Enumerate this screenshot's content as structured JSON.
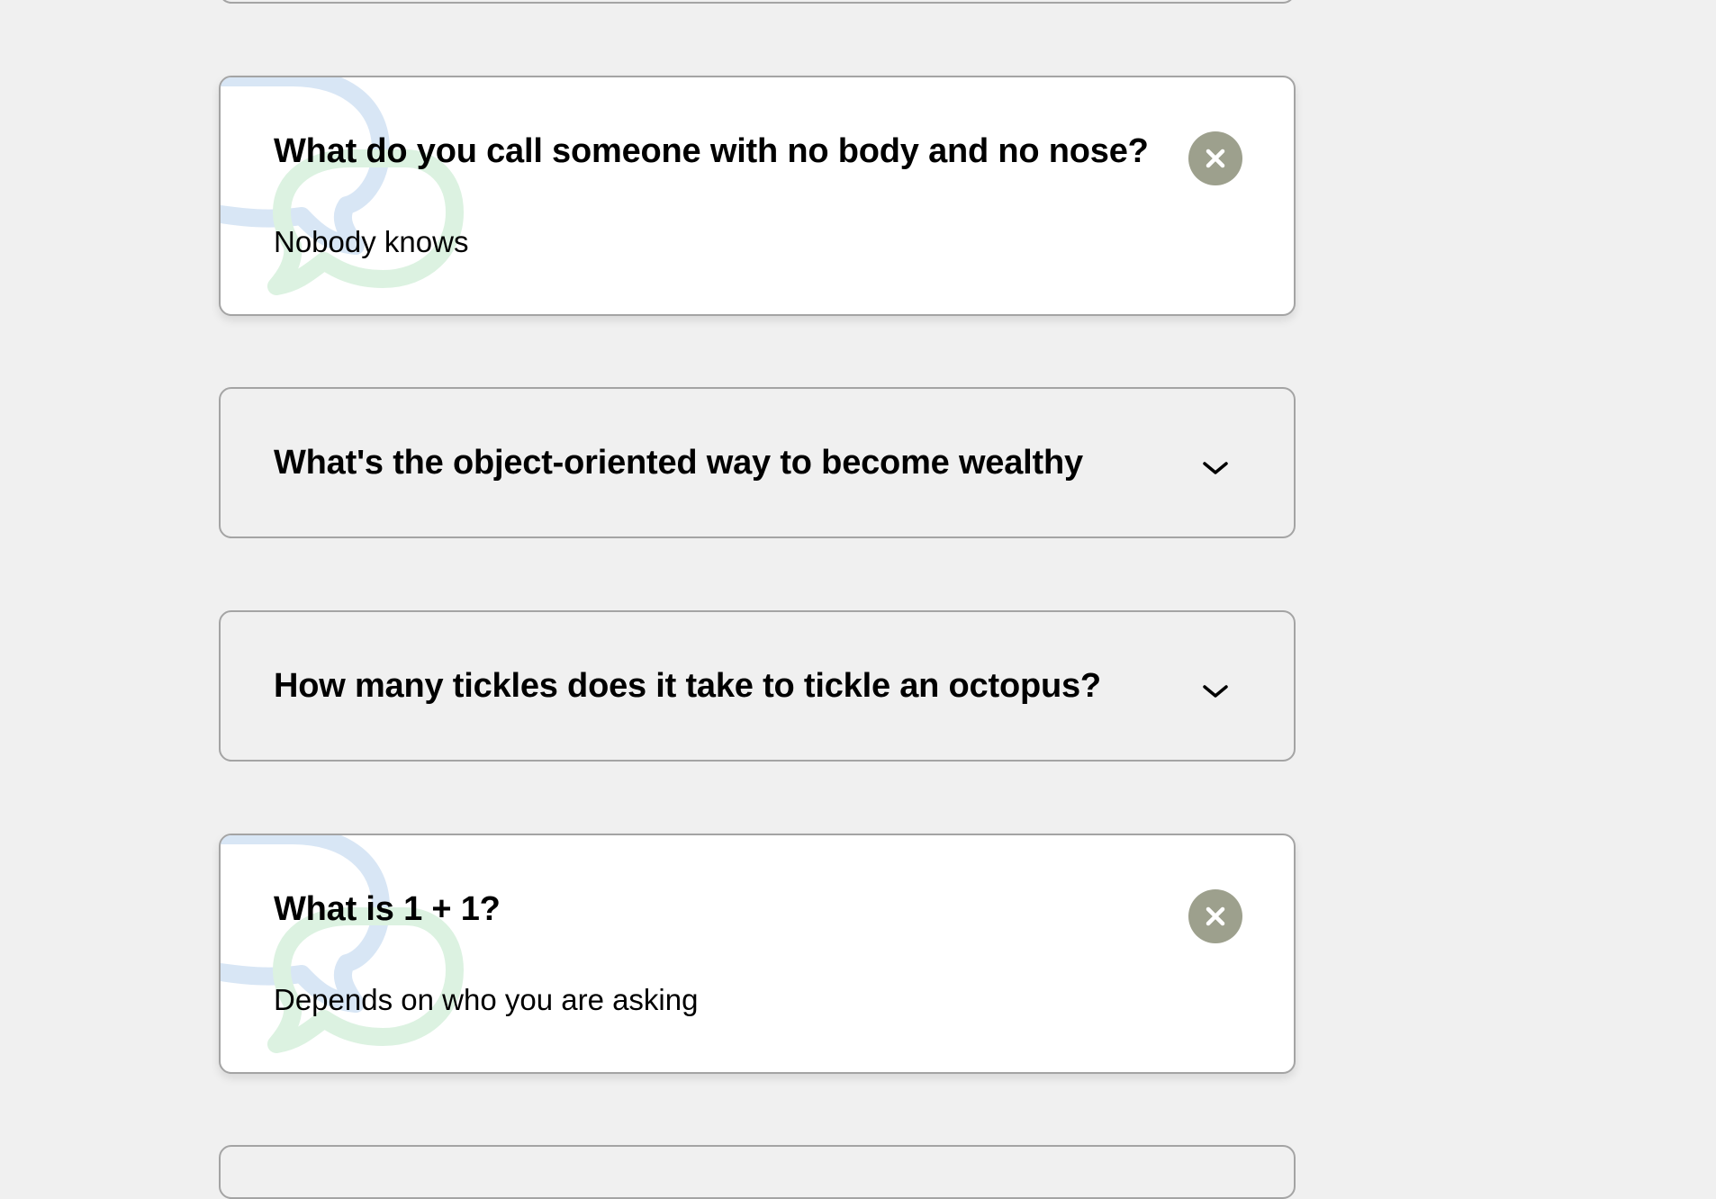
{
  "faq": {
    "items": [
      {
        "question": "What do you call someone with no body and no nose?",
        "answer": "Nobody knows",
        "state": "expanded"
      },
      {
        "question": "What's the object-oriented way to become wealthy",
        "state": "collapsed"
      },
      {
        "question": "How many tickles does it take to tickle an octopus?",
        "state": "collapsed"
      },
      {
        "question": "What is 1 + 1?",
        "answer": "Depends on who you are asking",
        "state": "expanded"
      }
    ]
  },
  "colors": {
    "page_background": "#f0f0f0",
    "card_open_background": "#ffffff",
    "card_border": "#a4a4a4",
    "close_button": "#9da08d",
    "bubble_blue": "#d8e6f5",
    "bubble_green": "#dcf2e1"
  },
  "icons": {
    "expanded_toggle": "close-icon",
    "collapsed_toggle": "chevron-down-icon",
    "decoration": "chat-bubbles-icon"
  }
}
